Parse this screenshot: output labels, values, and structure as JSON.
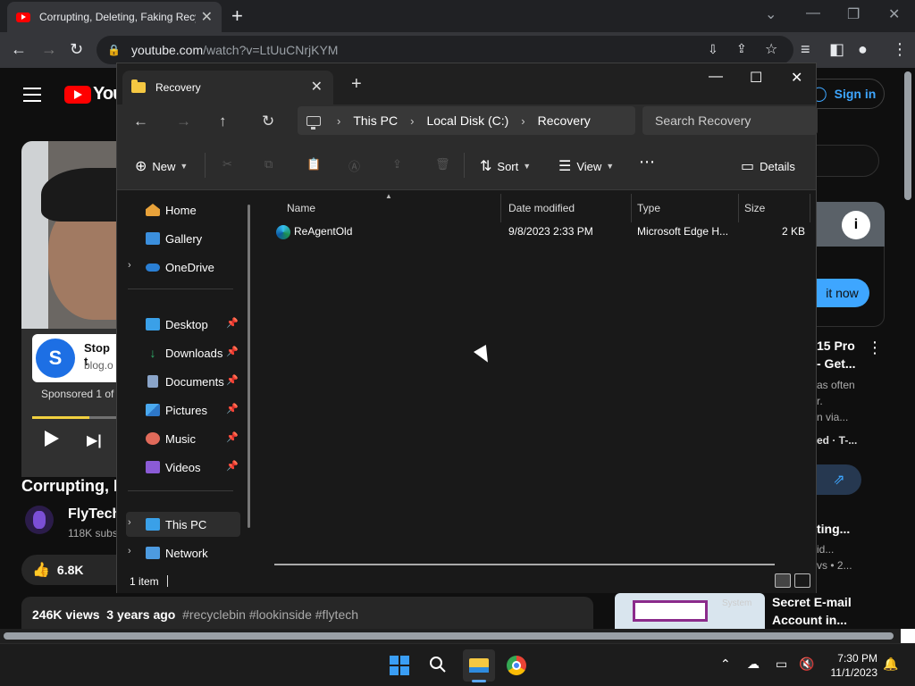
{
  "chrome": {
    "tab_title": "Corrupting, Deleting, Faking Recycle",
    "url_host": "youtube.com",
    "url_path": "/watch?v=LtUuCNrjKYM"
  },
  "youtube": {
    "logo_text": "You",
    "signin": "Sign in",
    "ad_title": "Stop t",
    "ad_domain": "blog.o",
    "sponsored": "Sponsored 1 of",
    "video_title": "Corrupting, D",
    "channel_name": "FlyTech",
    "channel_subs": "118K subs",
    "likes": "6.8K",
    "views": "246K views",
    "age": "3 years ago",
    "hashtags": "#recyclebin #lookinside #flytech",
    "ad_cta": "it now",
    "side_title_1": "15 Pro",
    "side_title_2": "- Get...",
    "side_desc_1": "as often",
    "side_desc_2": "r.",
    "side_desc_3": "n via...",
    "side_meta": "ed  · T-...",
    "side_video2_title": "ting...",
    "side_video2_meta1": "id...",
    "side_video2_meta2": "vs • 2...",
    "side_video3_title_1": "Secret E-mail",
    "side_video3_title_2": "Account in...",
    "thumb_label": "System"
  },
  "explorer": {
    "tab_title": "Recovery",
    "breadcrumb": [
      "This PC",
      "Local Disk (C:)",
      "Recovery"
    ],
    "search_placeholder": "Search Recovery",
    "toolbar": {
      "new": "New",
      "sort": "Sort",
      "view": "View",
      "details": "Details"
    },
    "nav": {
      "home": "Home",
      "gallery": "Gallery",
      "onedrive": "OneDrive",
      "desktop": "Desktop",
      "downloads": "Downloads",
      "documents": "Documents",
      "pictures": "Pictures",
      "music": "Music",
      "videos": "Videos",
      "thispc": "This PC",
      "network": "Network"
    },
    "columns": {
      "name": "Name",
      "date": "Date modified",
      "type": "Type",
      "size": "Size"
    },
    "files": [
      {
        "name": "ReAgentOld",
        "date": "9/8/2023 2:33 PM",
        "type": "Microsoft Edge H...",
        "size": "2 KB"
      }
    ],
    "status": "1 item"
  },
  "taskbar": {
    "time": "7:30 PM",
    "date": "11/1/2023"
  },
  "colors": {
    "accent": "#3ea6ff",
    "folder": "#f5c842",
    "explorer_bg": "#191919"
  }
}
